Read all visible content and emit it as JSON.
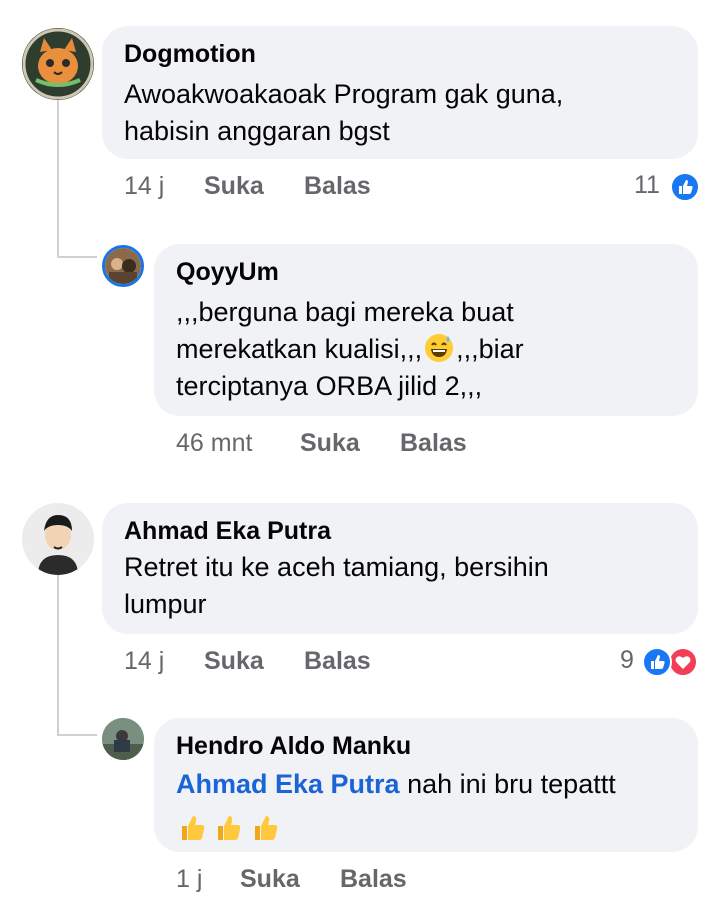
{
  "comments": [
    {
      "author": "Dogmotion",
      "text_line1": "Awoakwoakaoak Program gak guna,",
      "text_line2": "habisin anggaran bgst",
      "time": "14 j",
      "like_label": "Suka",
      "reply_label": "Balas",
      "reaction_count": "11",
      "reaction_icons": [
        "like-reaction-icon"
      ]
    },
    {
      "author": "QoyyUm",
      "text_line1": ",,,berguna bagi mereka buat",
      "text_line2a": "merekatkan kualisi,,,",
      "text_line2b": ",,,biar",
      "text_line3": "terciptanya ORBA jilid 2,,,",
      "emoji": "grinning-sweat-emoji",
      "time": "46 mnt",
      "like_label": "Suka",
      "reply_label": "Balas"
    },
    {
      "author": "Ahmad Eka Putra",
      "text_line1": "Retret itu ke aceh tamiang, bersihin",
      "text_line2": "lumpur",
      "time": "14 j",
      "like_label": "Suka",
      "reply_label": "Balas",
      "reaction_count": "9",
      "reaction_icons": [
        "like-reaction-icon",
        "love-reaction-icon"
      ]
    },
    {
      "author": "Hendro Aldo Manku",
      "mention": "Ahmad Eka Putra",
      "text": " nah ini bru tepattt",
      "emoji": "thumbs-up-emoji x3",
      "time": "1 j",
      "like_label": "Suka",
      "reply_label": "Balas"
    }
  ],
  "colors": {
    "bubble": "#f0f2f5",
    "meta_text": "#65676b",
    "mention": "#1b64d7",
    "like_blue": "#1877f2",
    "love_red": "#f33e58"
  }
}
